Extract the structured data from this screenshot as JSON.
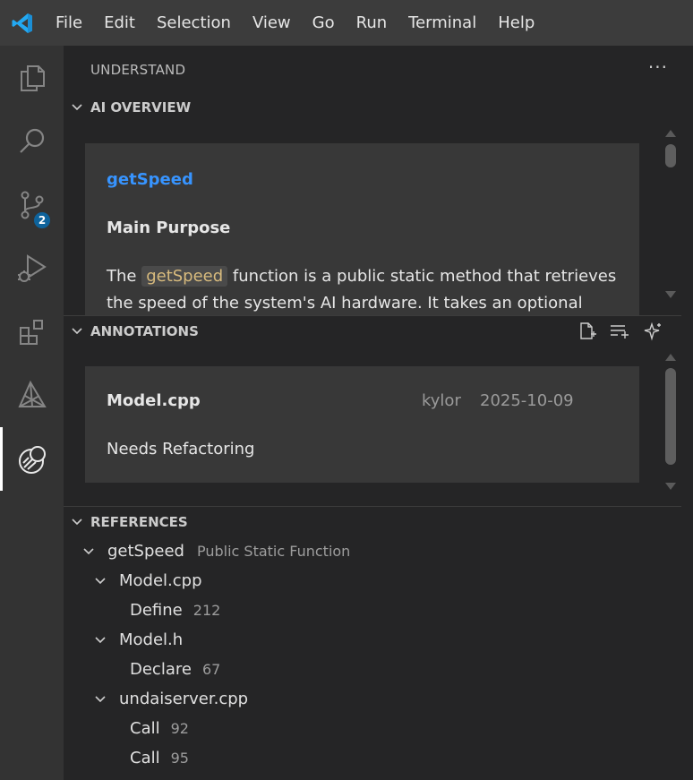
{
  "menu": {
    "items": [
      "File",
      "Edit",
      "Selection",
      "View",
      "Go",
      "Run",
      "Terminal",
      "Help"
    ]
  },
  "activity": {
    "icons": [
      "explorer-icon",
      "search-icon",
      "source-control-icon",
      "run-debug-icon",
      "extensions-icon",
      "understand-triangle-icon",
      "understand-ai-icon"
    ],
    "source_control_badge": "2"
  },
  "sidebar": {
    "title": "UNDERSTAND",
    "more": "···"
  },
  "overview": {
    "header": "AI OVERVIEW",
    "title": "getSpeed",
    "subtitle": "Main Purpose",
    "text_before": "The ",
    "code": "getSpeed",
    "text_after": " function is a public static method that retrieves the speed of the system's AI hardware. It takes an optional boolean"
  },
  "annotations": {
    "header": "ANNOTATIONS",
    "file": "Model.cpp",
    "author": "kylor",
    "date": "2025-10-09",
    "note": "Needs Refactoring"
  },
  "references": {
    "header": "REFERENCES",
    "root": {
      "name": "getSpeed",
      "desc": "Public Static Function"
    },
    "files": [
      {
        "name": "Model.cpp",
        "entries": [
          {
            "kind": "Define",
            "line": "212"
          }
        ]
      },
      {
        "name": "Model.h",
        "entries": [
          {
            "kind": "Declare",
            "line": "67"
          }
        ]
      },
      {
        "name": "undaiserver.cpp",
        "entries": [
          {
            "kind": "Call",
            "line": "92"
          },
          {
            "kind": "Call",
            "line": "95"
          }
        ]
      }
    ]
  },
  "colors": {
    "accent": "#3794ff",
    "badge": "#0e639c",
    "code": "#d7ba7d"
  }
}
